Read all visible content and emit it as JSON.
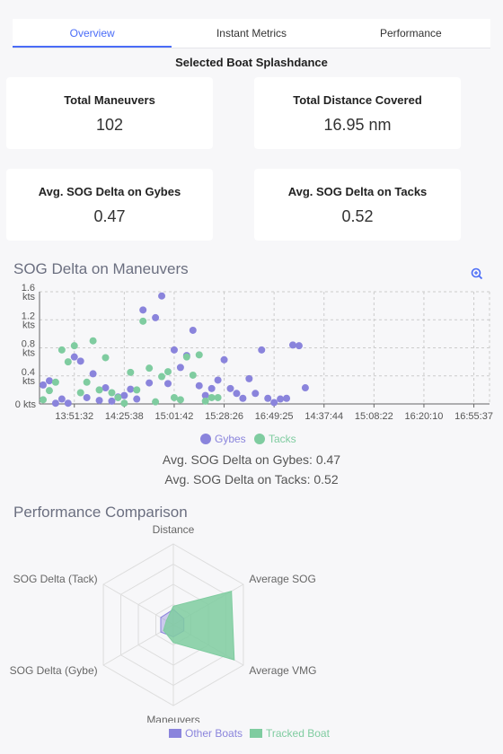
{
  "tabs": [
    {
      "label": "Overview",
      "active": true
    },
    {
      "label": "Instant Metrics",
      "active": false
    },
    {
      "label": "Performance",
      "active": false
    }
  ],
  "selected_boat": "Selected Boat Splashdance",
  "cards": [
    {
      "title": "Total Maneuvers",
      "value": "102"
    },
    {
      "title": "Total Distance Covered",
      "value": "16.95 nm"
    },
    {
      "title": "Avg. SOG Delta on Gybes",
      "value": "0.47"
    },
    {
      "title": "Avg. SOG Delta on Tacks",
      "value": "0.52"
    }
  ],
  "colors": {
    "accent": "#4a6cf7",
    "gybes": "#8a84dc",
    "tacks": "#7fcca0"
  },
  "scatter_title": "SOG Delta on Maneuvers",
  "zoom_icon": "zoom-in-icon",
  "avg_gybes_text": "Avg. SOG Delta on Gybes: 0.47",
  "avg_tacks_text": "Avg. SOG Delta on Tacks: 0.52",
  "radar_title": "Performance Comparison",
  "chart_data": [
    {
      "type": "scatter",
      "ylim": [
        0,
        1.6
      ],
      "yticks": [
        "0 kts",
        "0.4 kts",
        "0.8 kts",
        "1.2 kts",
        "1.6 kts"
      ],
      "xticks": [
        "13:51:32",
        "14:25:38",
        "15:01:42",
        "15:28:26",
        "16:49:25",
        "14:37:44",
        "15:08:22",
        "16:20:10",
        "16:55:37"
      ],
      "grid": true,
      "legend_placement": "bottom",
      "series": [
        {
          "name": "Gybes",
          "values": [
            0.27,
            0.33,
            0.01,
            0.07,
            0.01,
            0.67,
            0.61,
            0.09,
            0.43,
            0.05,
            0.23,
            0.04,
            0.1,
            0.12,
            0.21,
            0.07,
            1.34,
            0.3,
            1.23,
            1.54,
            0.29,
            0.77,
            0.52,
            0.69,
            1.05,
            0.26,
            0.12,
            0.22,
            0.34,
            0.63,
            0.22,
            0.15,
            0.08,
            0.36,
            0.15,
            0.77,
            0.08,
            0.02,
            0.07,
            0.08,
            0.84,
            0.83,
            0.23
          ]
        },
        {
          "name": "Tacks",
          "values": [
            0.06,
            0.19,
            0.31,
            0.77,
            0.6,
            0.83,
            0.16,
            0.31,
            0.9,
            0.2,
            0.66,
            0.16,
            0.09,
            0.01,
            0.45,
            0.2,
            1.18,
            0.51,
            0.03,
            0.39,
            0.46,
            0.09,
            0.06,
            0.67,
            0.41,
            0.7,
            0.04,
            0.09,
            0.09
          ]
        }
      ]
    },
    {
      "type": "radar",
      "axes": [
        "Distance",
        "Average SOG",
        "Average VMG",
        "Maneuvers",
        "SOG Delta (Gybe)",
        "SOG Delta (Tack)"
      ],
      "range": [
        0,
        1
      ],
      "legend_placement": "bottom",
      "series": [
        {
          "name": "Other Boats",
          "values": [
            0.19,
            0.15,
            0.15,
            0.15,
            0.18,
            0.18
          ]
        },
        {
          "name": "Tracked Boat",
          "values": [
            0.23,
            0.83,
            0.87,
            0.22,
            0.14,
            0.1
          ]
        }
      ]
    }
  ]
}
